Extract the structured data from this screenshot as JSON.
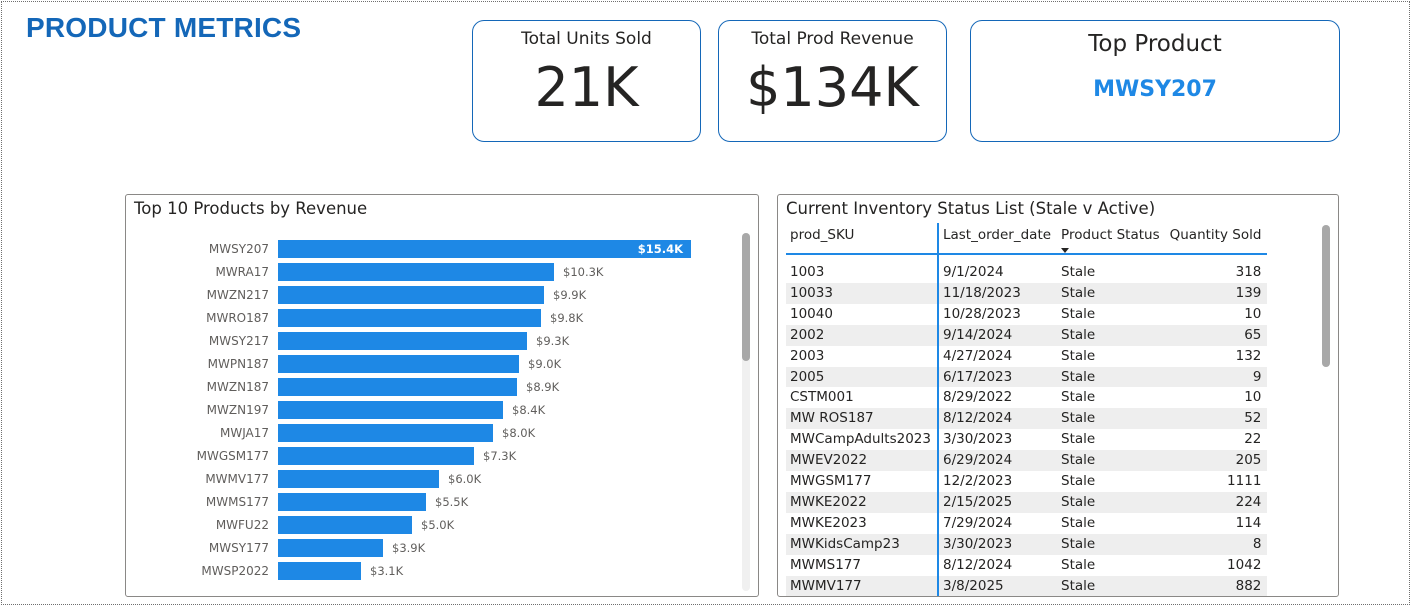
{
  "page": {
    "title": "PRODUCT METRICS"
  },
  "kpis": {
    "units": {
      "label": "Total Units Sold",
      "value": "21K"
    },
    "revenue": {
      "label": "Total Prod Revenue",
      "value": "$134K"
    },
    "top_product": {
      "label": "Top Product",
      "value": "MWSY207"
    }
  },
  "bar_panel": {
    "title": "Top 10 Products by Revenue"
  },
  "chart_data": {
    "type": "bar",
    "orientation": "horizontal",
    "title": "Top 10 Products by Revenue",
    "categories": [
      "MWSY207",
      "MWRA17",
      "MWZN217",
      "MWRO187",
      "MWSY217",
      "MWPN187",
      "MWZN187",
      "MWZN197",
      "MWJA17",
      "MWGSM177",
      "MWMV177",
      "MWMS177",
      "MWFU22",
      "MWSY177",
      "MWSP2022"
    ],
    "values": [
      15400,
      10300,
      9900,
      9800,
      9300,
      9000,
      8900,
      8400,
      8000,
      7300,
      6000,
      5500,
      5000,
      3900,
      3100
    ],
    "value_labels": [
      "$15.4K",
      "$10.3K",
      "$9.9K",
      "$9.8K",
      "$9.3K",
      "$9.0K",
      "$8.9K",
      "$8.4K",
      "$8.0K",
      "$7.3K",
      "$6.0K",
      "$5.5K",
      "$5.0K",
      "$3.9K",
      "$3.1K"
    ],
    "xlim": [
      0,
      15400
    ],
    "grid": false,
    "color": "#1e88e5"
  },
  "inventory": {
    "title": "Current Inventory Status List (Stale v Active)",
    "columns": [
      "prod_SKU",
      "Last_order_date",
      "Product Status",
      "Quantity Sold"
    ],
    "rows": [
      [
        "1003",
        "9/1/2024",
        "Stale",
        "318"
      ],
      [
        "10033",
        "11/18/2023",
        "Stale",
        "139"
      ],
      [
        "10040",
        "10/28/2023",
        "Stale",
        "10"
      ],
      [
        "2002",
        "9/14/2024",
        "Stale",
        "65"
      ],
      [
        "2003",
        "4/27/2024",
        "Stale",
        "132"
      ],
      [
        "2005",
        "6/17/2023",
        "Stale",
        "9"
      ],
      [
        "CSTM001",
        "8/29/2022",
        "Stale",
        "10"
      ],
      [
        "MW ROS187",
        "8/12/2024",
        "Stale",
        "52"
      ],
      [
        "MWCampAdults2023",
        "3/30/2023",
        "Stale",
        "22"
      ],
      [
        "MWEV2022",
        "6/29/2024",
        "Stale",
        "205"
      ],
      [
        "MWGSM177",
        "12/2/2023",
        "Stale",
        "1111"
      ],
      [
        "MWKE2022",
        "2/15/2025",
        "Stale",
        "224"
      ],
      [
        "MWKE2023",
        "7/29/2024",
        "Stale",
        "114"
      ],
      [
        "MWKidsCamp23",
        "3/30/2023",
        "Stale",
        "8"
      ],
      [
        "MWMS177",
        "8/12/2024",
        "Stale",
        "1042"
      ],
      [
        "MWMV177",
        "3/8/2025",
        "Stale",
        "882"
      ]
    ]
  },
  "colors": {
    "title": "#1467b8",
    "accent": "#1e88e5",
    "text": "#252423"
  }
}
